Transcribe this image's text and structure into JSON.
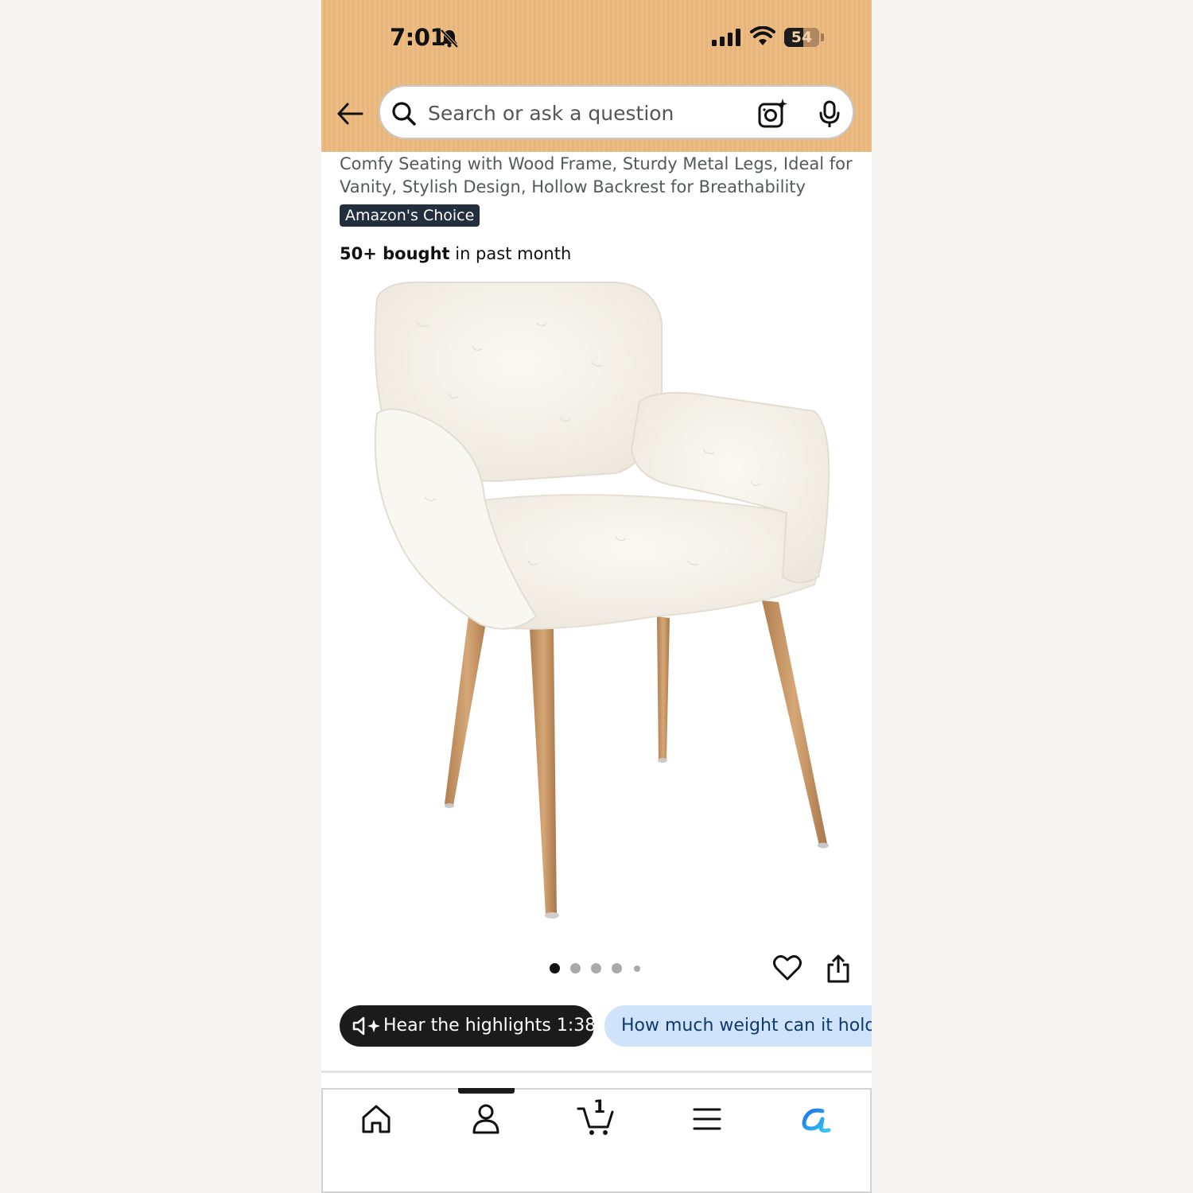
{
  "status_bar": {
    "time": "7:01",
    "battery": "54",
    "battery_level": 0.54
  },
  "header": {
    "search_placeholder": "Search or ask a question",
    "background_color": "#edbc83"
  },
  "product": {
    "title_partial": "Comfy Seating with Wood Frame, Sturdy Metal Legs, Ideal for Vanity, Stylish Design, Hollow Backrest for Breathability",
    "badge": "Amazon's Choice",
    "bought_bold": "50+ bought",
    "bought_rest": " in past month",
    "image_description_icon": "white-faux-fur-armchair-image"
  },
  "carousel": {
    "total_dots": 5,
    "active_index": 0
  },
  "actions": {
    "hear_highlights": "Hear the highlights 1:38",
    "question_pill": "How much weight can it hold"
  },
  "tabbar": {
    "items": [
      "home-icon",
      "account-icon",
      "cart-icon",
      "menu-icon",
      "rufus-icon"
    ],
    "cart_count": "1",
    "active_index": 1
  }
}
